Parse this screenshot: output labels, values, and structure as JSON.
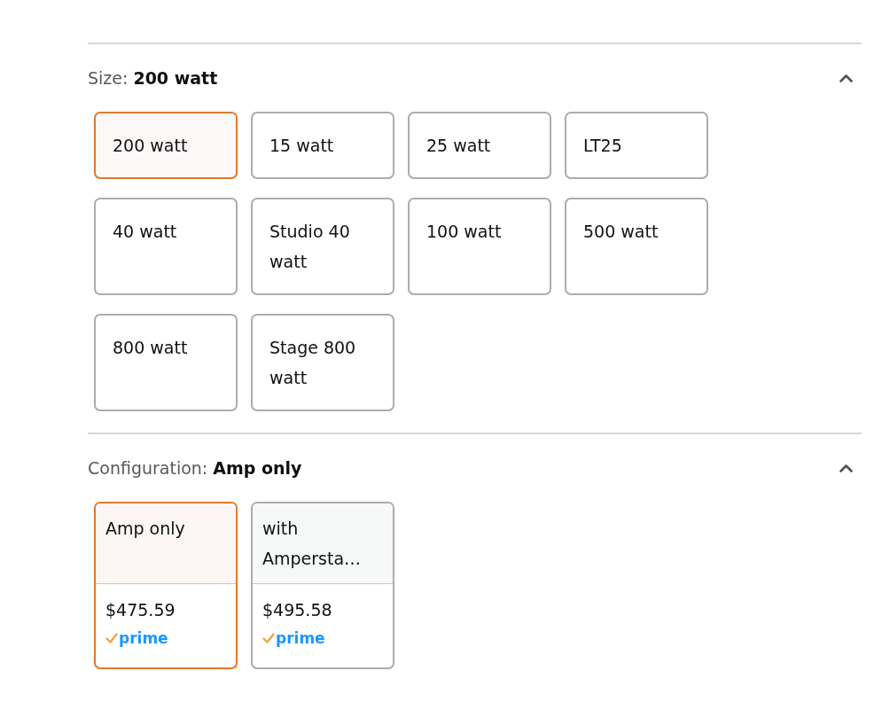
{
  "sections": [
    {
      "label": "Size:",
      "value": "200 watt",
      "expanded": true,
      "kind": "text",
      "options": [
        {
          "label": "200 watt",
          "selected": true
        },
        {
          "label": "15 watt",
          "selected": false
        },
        {
          "label": "25 watt",
          "selected": false
        },
        {
          "label": "LT25",
          "selected": false
        },
        {
          "label": "40 watt",
          "selected": false
        },
        {
          "label": "Studio 40 watt",
          "selected": false
        },
        {
          "label": "100 watt",
          "selected": false
        },
        {
          "label": "500 watt",
          "selected": false
        },
        {
          "label": "800 watt",
          "selected": false
        },
        {
          "label": "Stage 800 watt",
          "selected": false
        }
      ]
    },
    {
      "label": "Configuration:",
      "value": "Amp only",
      "expanded": true,
      "kind": "priced",
      "options": [
        {
          "label": "Amp only",
          "price": "$475.59",
          "badge": "prime",
          "selected": true
        },
        {
          "label": "with Ampersta…",
          "price": "$495.58",
          "badge": "prime",
          "selected": false
        }
      ]
    }
  ]
}
